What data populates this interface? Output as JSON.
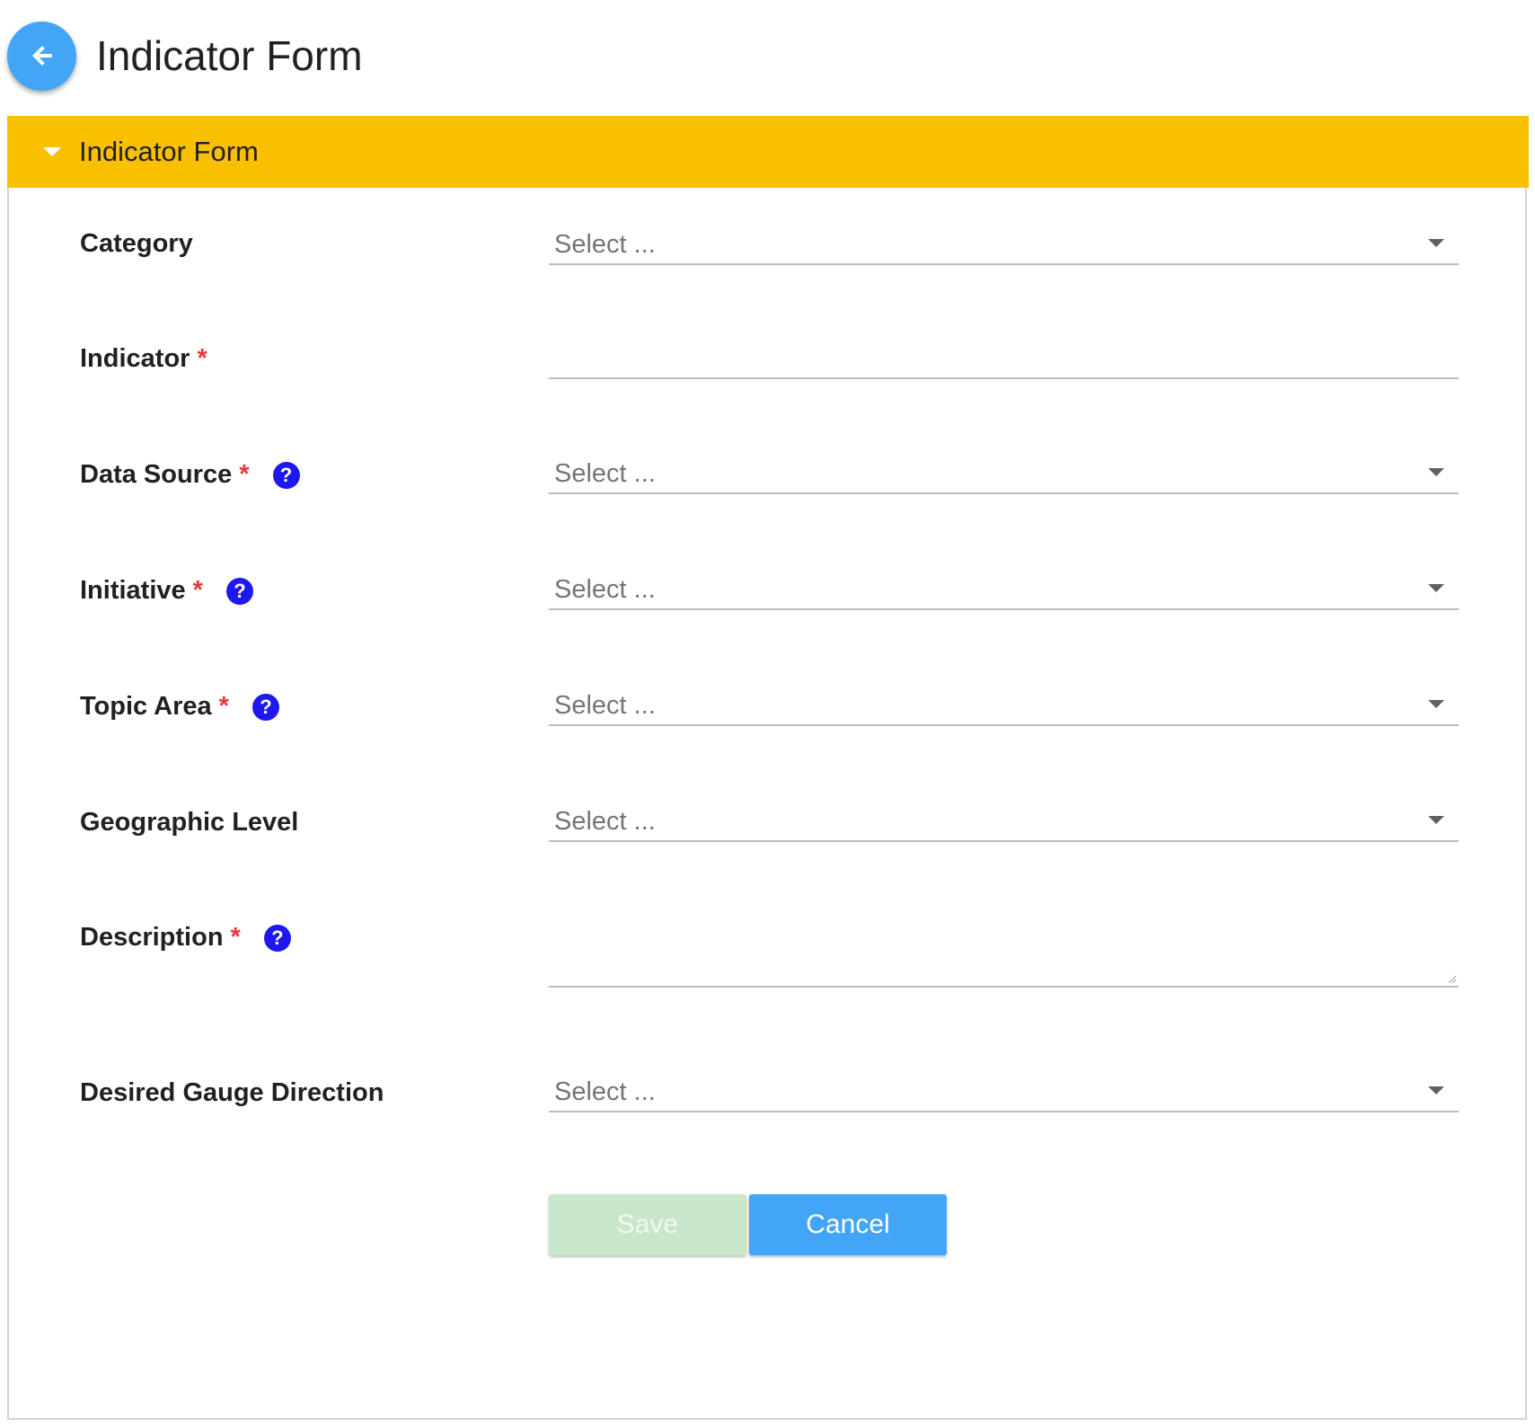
{
  "header": {
    "title": "Indicator Form",
    "back_icon": "arrow-left-icon",
    "back_color": "#42a5f5"
  },
  "panel": {
    "title": "Indicator Form",
    "header_color": "#f9c000"
  },
  "form": {
    "category": {
      "label": "Category",
      "placeholder": "Select ..."
    },
    "indicator": {
      "label": "Indicator",
      "required_mark": "*",
      "value": ""
    },
    "data_source": {
      "label": "Data Source",
      "required_mark": "*",
      "help": "?",
      "placeholder": "Select ..."
    },
    "initiative": {
      "label": "Initiative",
      "required_mark": "*",
      "help": "?",
      "placeholder": "Select ..."
    },
    "topic_area": {
      "label": "Topic Area",
      "required_mark": "*",
      "help": "?",
      "placeholder": "Select ..."
    },
    "geographic_level": {
      "label": "Geographic Level",
      "placeholder": "Select ..."
    },
    "description": {
      "label": "Description",
      "required_mark": "*",
      "help": "?",
      "value": ""
    },
    "gauge_direction": {
      "label": "Desired Gauge Direction",
      "placeholder": "Select ..."
    }
  },
  "actions": {
    "save_label": "Save",
    "cancel_label": "Cancel",
    "save_color": "#c8e6c9",
    "cancel_color": "#42a5f5"
  },
  "colors": {
    "required": "#e53935",
    "help": "#1e18f0"
  }
}
